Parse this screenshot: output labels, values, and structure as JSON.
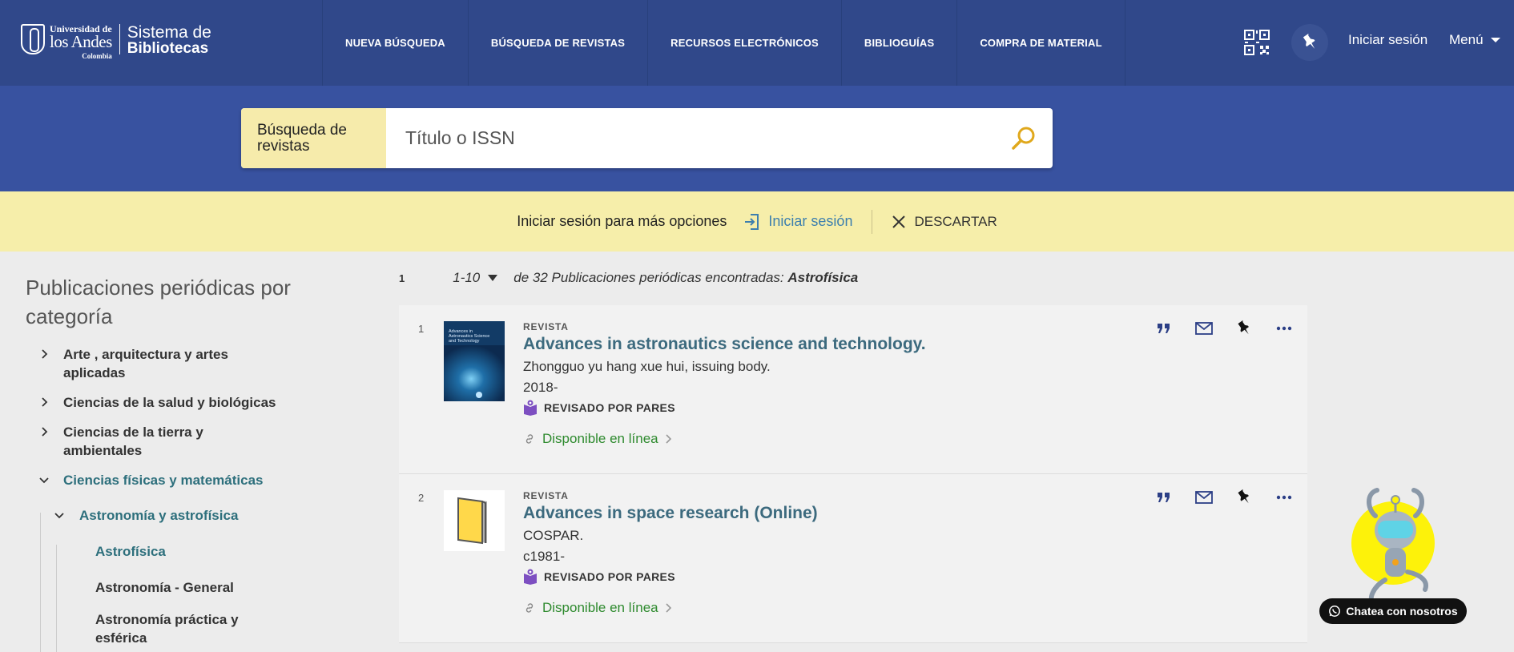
{
  "header": {
    "logo": {
      "university_line1": "Universidad de",
      "university_line2": "los Andes",
      "country": "Colombia",
      "system_line1": "Sistema de",
      "system_line2": "Bibliotecas"
    },
    "nav": [
      {
        "label": "NUEVA BÚSQUEDA"
      },
      {
        "label": "BÚSQUEDA DE REVISTAS"
      },
      {
        "label": "RECURSOS ELECTRÓNICOS"
      },
      {
        "label": "BIBLIOGUÍAS"
      },
      {
        "label": "COMPRA DE MATERIAL"
      }
    ],
    "login_label": "Iniciar sesión",
    "menu_label": "Menú"
  },
  "search": {
    "scope_label": "Búsqueda de revistas",
    "placeholder": "Título o ISSN",
    "value": ""
  },
  "banner": {
    "text": "Iniciar sesión para más opciones",
    "login_label": "Iniciar sesión",
    "dismiss_label": "DESCARTAR"
  },
  "sidebar": {
    "title": "Publicaciones periódicas por categoría",
    "categories": [
      {
        "label": "Arte , arquitectura y artes aplicadas"
      },
      {
        "label": "Ciencias de la salud y biológicas"
      },
      {
        "label": "Ciencias de la tierra y ambientales"
      },
      {
        "label": "Ciencias físicas y matemáticas"
      }
    ],
    "subcategory": "Astronomía y astrofísica",
    "leaves": [
      {
        "label": "Astrofísica"
      },
      {
        "label": "Astronomía - General"
      },
      {
        "label": "Astronomía práctica y esférica"
      }
    ]
  },
  "results": {
    "page": "1",
    "range": "1-10",
    "count_text": "de 32 Publicaciones periódicas encontradas:",
    "query": "Astrofísica",
    "items": [
      {
        "num": "1",
        "type": "REVISTA",
        "title": "Advances in astronautics science and technology.",
        "author": "Zhongguo yu hang xue hui, issuing body.",
        "date": "2018-",
        "peer": "REVISADO POR PARES",
        "availability": "Disponible en línea",
        "cover_text": "Advances in Astronautics Science and Technology"
      },
      {
        "num": "2",
        "type": "REVISTA",
        "title": "Advances in space research (Online)",
        "author": "COSPAR.",
        "date": "c1981-",
        "peer": "REVISADO POR PARES",
        "availability": "Disponible en línea",
        "cover_text": ""
      }
    ]
  },
  "chat": {
    "label": "Chatea con nosotros"
  },
  "colors": {
    "nav_bg": "#30488a",
    "search_band": "#3852a0",
    "banner_bg": "#f6eeaa",
    "accent_teal": "#2d6f7c",
    "available_green": "#2e8a2e",
    "search_icon": "#e0a81c",
    "peer_icon": "#7d4fc1"
  }
}
